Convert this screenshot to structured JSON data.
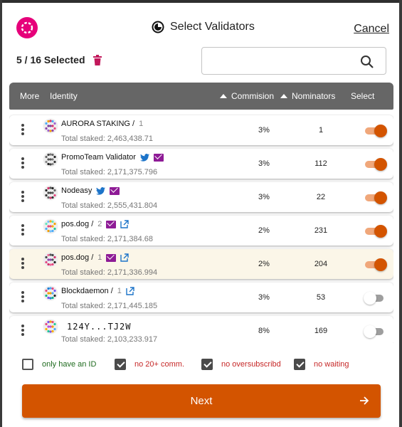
{
  "header": {
    "title": "Select Validators",
    "cancel_label": "Cancel"
  },
  "selection": {
    "count_text": "5 / 16 Selected"
  },
  "search": {
    "value": "",
    "placeholder": ""
  },
  "table": {
    "columns": {
      "more": "More",
      "identity": "Identity",
      "commission": "Commision",
      "nominators": "Nominators",
      "select": "Select"
    },
    "rows": [
      {
        "name": "AURORA STAKING /",
        "sub": "1",
        "staked": "Total staked: 2,463,438.71",
        "commission": "3%",
        "nominators": "1",
        "selected": true,
        "highlight": false
      },
      {
        "name": "PromoTeam Validator",
        "sub": "",
        "staked": "Total staked: 2,171,375.796",
        "commission": "3%",
        "nominators": "112",
        "selected": true,
        "highlight": false
      },
      {
        "name": "Nodeasy",
        "sub": "",
        "staked": "Total staked: 2,555,431.804",
        "commission": "3%",
        "nominators": "22",
        "selected": true,
        "highlight": false
      },
      {
        "name": "pos.dog /",
        "sub": "2",
        "staked": "Total staked: 2,171,384.68",
        "commission": "2%",
        "nominators": "231",
        "selected": true,
        "highlight": false
      },
      {
        "name": "pos.dog /",
        "sub": "1",
        "staked": "Total staked: 2,171,336.994",
        "commission": "2%",
        "nominators": "204",
        "selected": true,
        "highlight": true
      },
      {
        "name": "Blockdaemon /",
        "sub": "1",
        "staked": "Total staked: 2,171,445.185",
        "commission": "3%",
        "nominators": "53",
        "selected": false,
        "highlight": false
      },
      {
        "name": "124Y...TJ2W",
        "sub": "",
        "staked": "Total staked: 2,103,233.917",
        "commission": "8%",
        "nominators": "169",
        "selected": false,
        "highlight": false
      }
    ]
  },
  "filters": [
    {
      "label": "only have an ID",
      "checked": false
    },
    {
      "label": "no 20+ comm.",
      "checked": true
    },
    {
      "label": "no oversubscribd",
      "checked": true
    },
    {
      "label": "no waiting",
      "checked": true
    }
  ],
  "next_button": {
    "label": "Next"
  },
  "colors": {
    "accent": "#d35400",
    "brand": "#e6007a",
    "header_bg": "#666666",
    "highlight_row": "#fbf6e8",
    "id_filter_green": "#1f6b1f",
    "filter_red": "#c62828"
  },
  "icons": [
    "polkadot-logo",
    "stake-icon",
    "trash-icon",
    "search-icon",
    "kebab-icon",
    "identicon",
    "twitter-icon",
    "mail-icon",
    "external-link-icon",
    "arrow-right-icon"
  ]
}
